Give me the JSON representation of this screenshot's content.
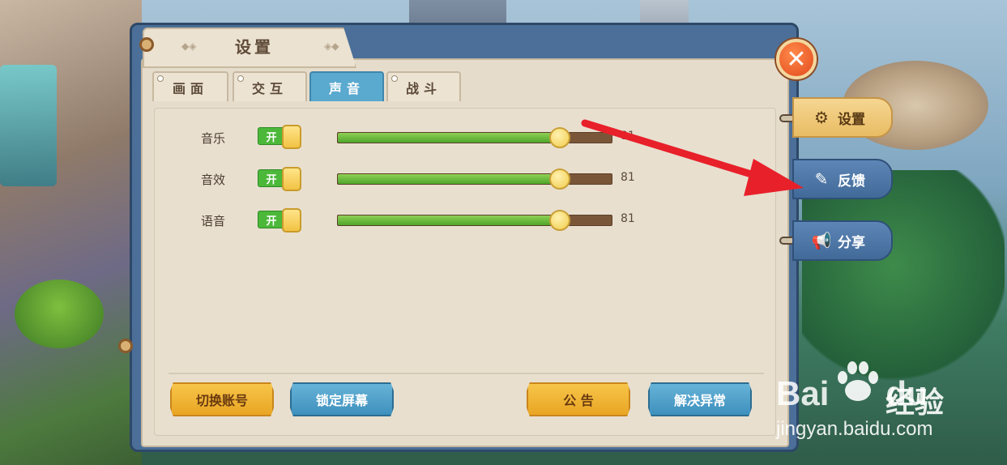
{
  "dialog": {
    "title": "设置",
    "close_icon": "close-x-icon"
  },
  "tabs": [
    {
      "label": "画面",
      "active": false
    },
    {
      "label": "交互",
      "active": false
    },
    {
      "label": "声音",
      "active": true
    },
    {
      "label": "战斗",
      "active": false
    }
  ],
  "audio": [
    {
      "label": "音乐",
      "toggle": "开",
      "value": 81,
      "value_text": "81",
      "max": 100
    },
    {
      "label": "音效",
      "toggle": "开",
      "value": 81,
      "value_text": "81",
      "max": 100
    },
    {
      "label": "语音",
      "toggle": "开",
      "value": 81,
      "value_text": "81",
      "max": 100
    }
  ],
  "footer_buttons": {
    "switch_account": "切换账号",
    "lock_screen": "锁定屏幕",
    "announcement": "公 告",
    "fix_issue": "解决异常"
  },
  "side_tabs": [
    {
      "label": "设置",
      "icon": "gear-icon",
      "active": true
    },
    {
      "label": "反馈",
      "icon": "edit-icon",
      "active": false
    },
    {
      "label": "分享",
      "icon": "megaphone-icon",
      "active": false
    }
  ],
  "watermark": {
    "brand_left": "Bai",
    "brand_right": "du",
    "brand_cn": "经验",
    "url": "jingyan.baidu.com"
  },
  "colors": {
    "active_tab": "#5aa9cf",
    "slider_fill": "#4ea62a",
    "slider_track": "#7a5638",
    "toggle_on": "#4cb83a",
    "annotation_arrow": "#e8202a"
  }
}
